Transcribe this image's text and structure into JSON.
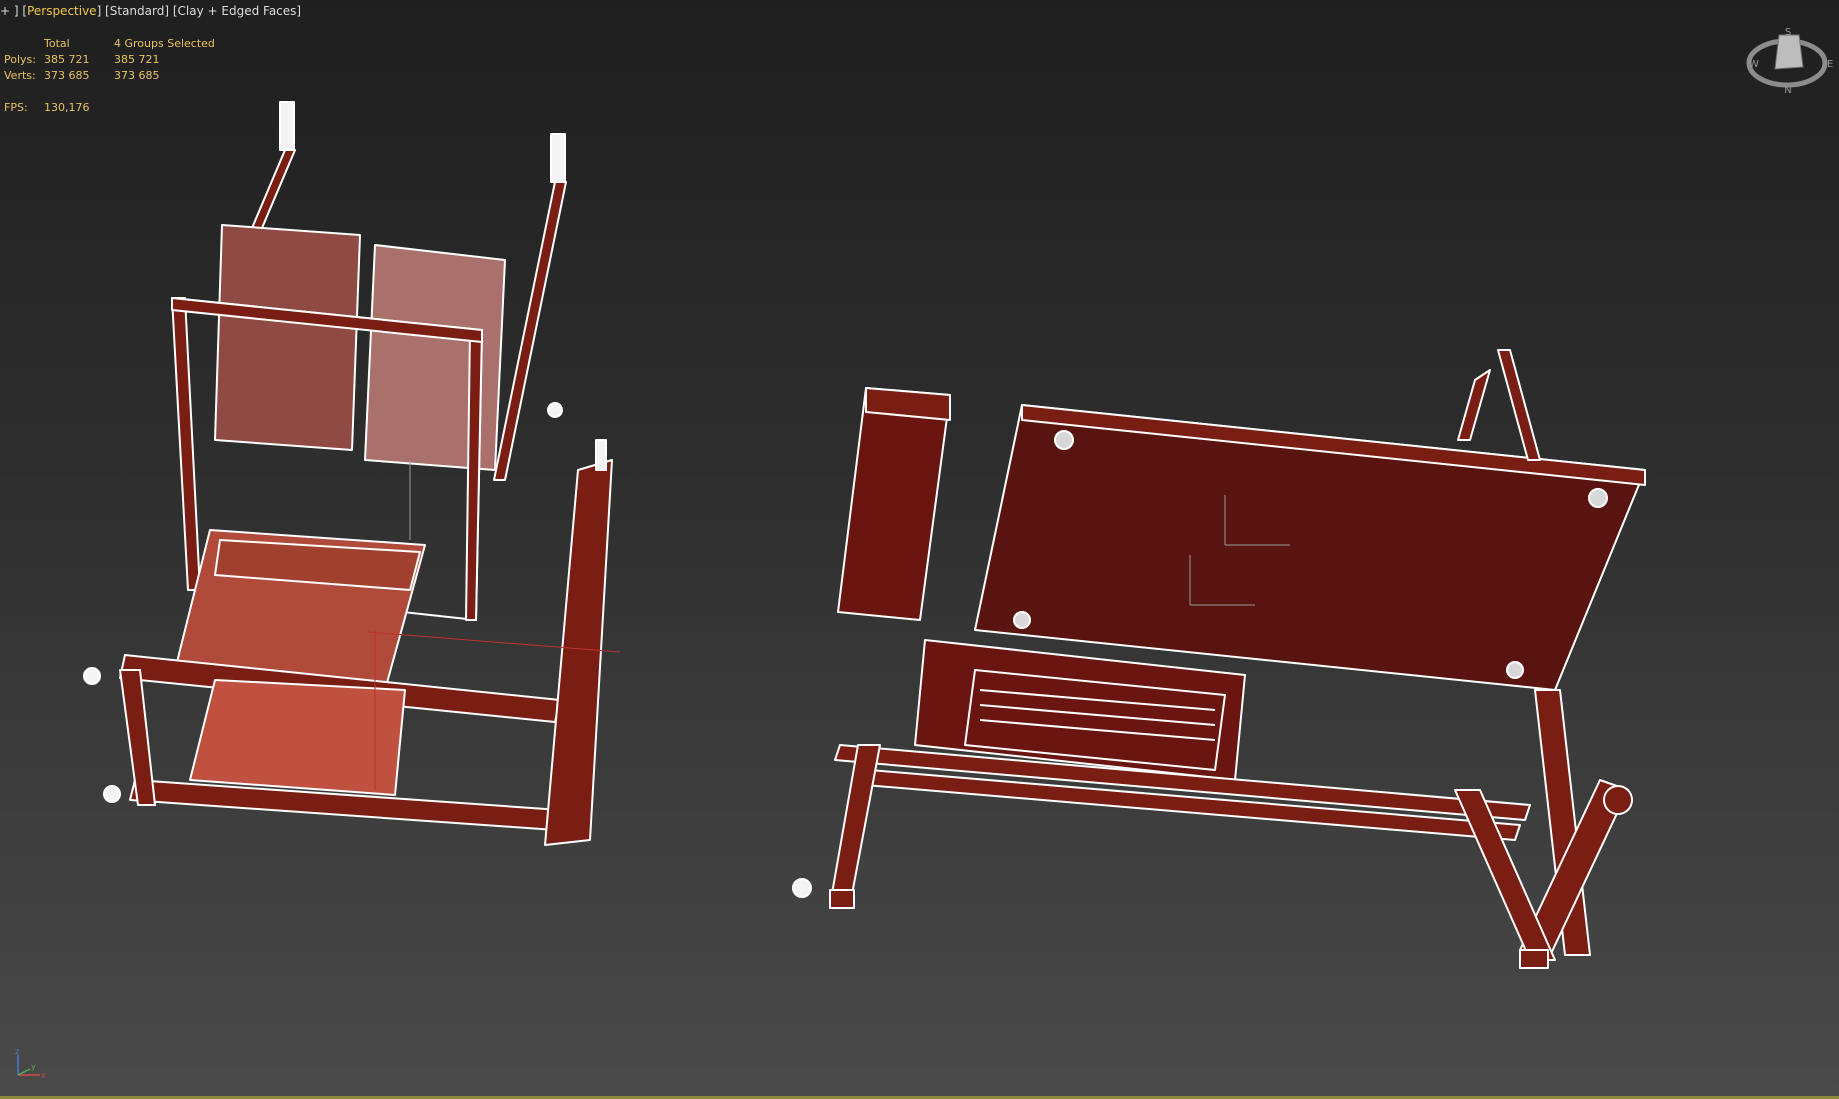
{
  "viewport": {
    "label_parts": [
      "+",
      "Perspective",
      "Standard",
      "Clay + Edged Faces"
    ]
  },
  "stats": {
    "header_total": "Total",
    "header_selected": "4 Groups Selected",
    "polys_label": "Polys:",
    "polys_total": "385 721",
    "polys_selected": "385 721",
    "verts_label": "Verts:",
    "verts_total": "373 685",
    "verts_selected": "373 685",
    "fps_label": "FPS:",
    "fps_value": "130,176"
  },
  "viewcube": {
    "n": "N",
    "s": "S",
    "e": "E",
    "w": "W"
  },
  "axis": {
    "x": "x",
    "y": "y",
    "z": "z"
  },
  "colors": {
    "accent": "#f3c84c",
    "stats": "#e8c35e",
    "model_face": "#7a1e14",
    "model_edge": "#ffffff"
  }
}
